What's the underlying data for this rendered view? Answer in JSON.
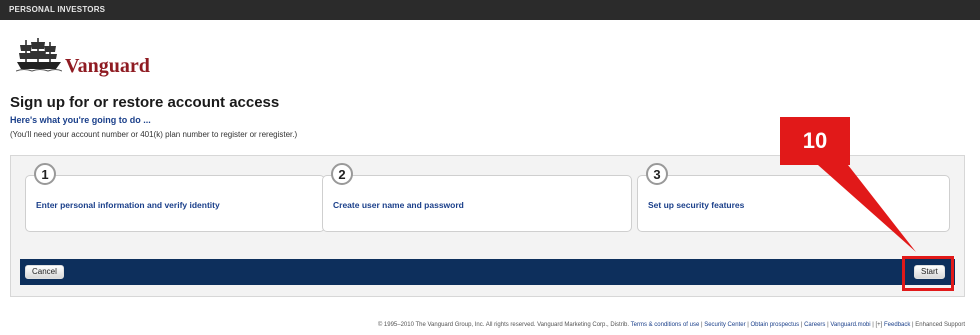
{
  "topbar": {
    "label": "PERSONAL INVESTORS"
  },
  "logo": {
    "name": "Vanguard"
  },
  "page": {
    "title": "Sign up for or restore account access",
    "subtitle": "Here's what you're going to do ...",
    "note": "(You'll need your account number or 401(k) plan number to register or reregister.)"
  },
  "steps": [
    {
      "number": "1",
      "label": "Enter personal information and verify identity"
    },
    {
      "number": "2",
      "label": "Create user name and password"
    },
    {
      "number": "3",
      "label": "Set up security features"
    }
  ],
  "actions": {
    "cancel_label": "Cancel",
    "start_label": "Start"
  },
  "annotation": {
    "label": "10",
    "color": "#e11919"
  },
  "footer": {
    "copyright": "© 1995–2010  The Vanguard Group, Inc. All rights reserved. Vanguard Marketing Corp., Distrib.",
    "links": [
      "Terms & conditions of use",
      "Security Center",
      "Obtain prospectus",
      "Careers",
      "Vanguard.mobi",
      "Feedback",
      "Enhanced Support"
    ]
  }
}
